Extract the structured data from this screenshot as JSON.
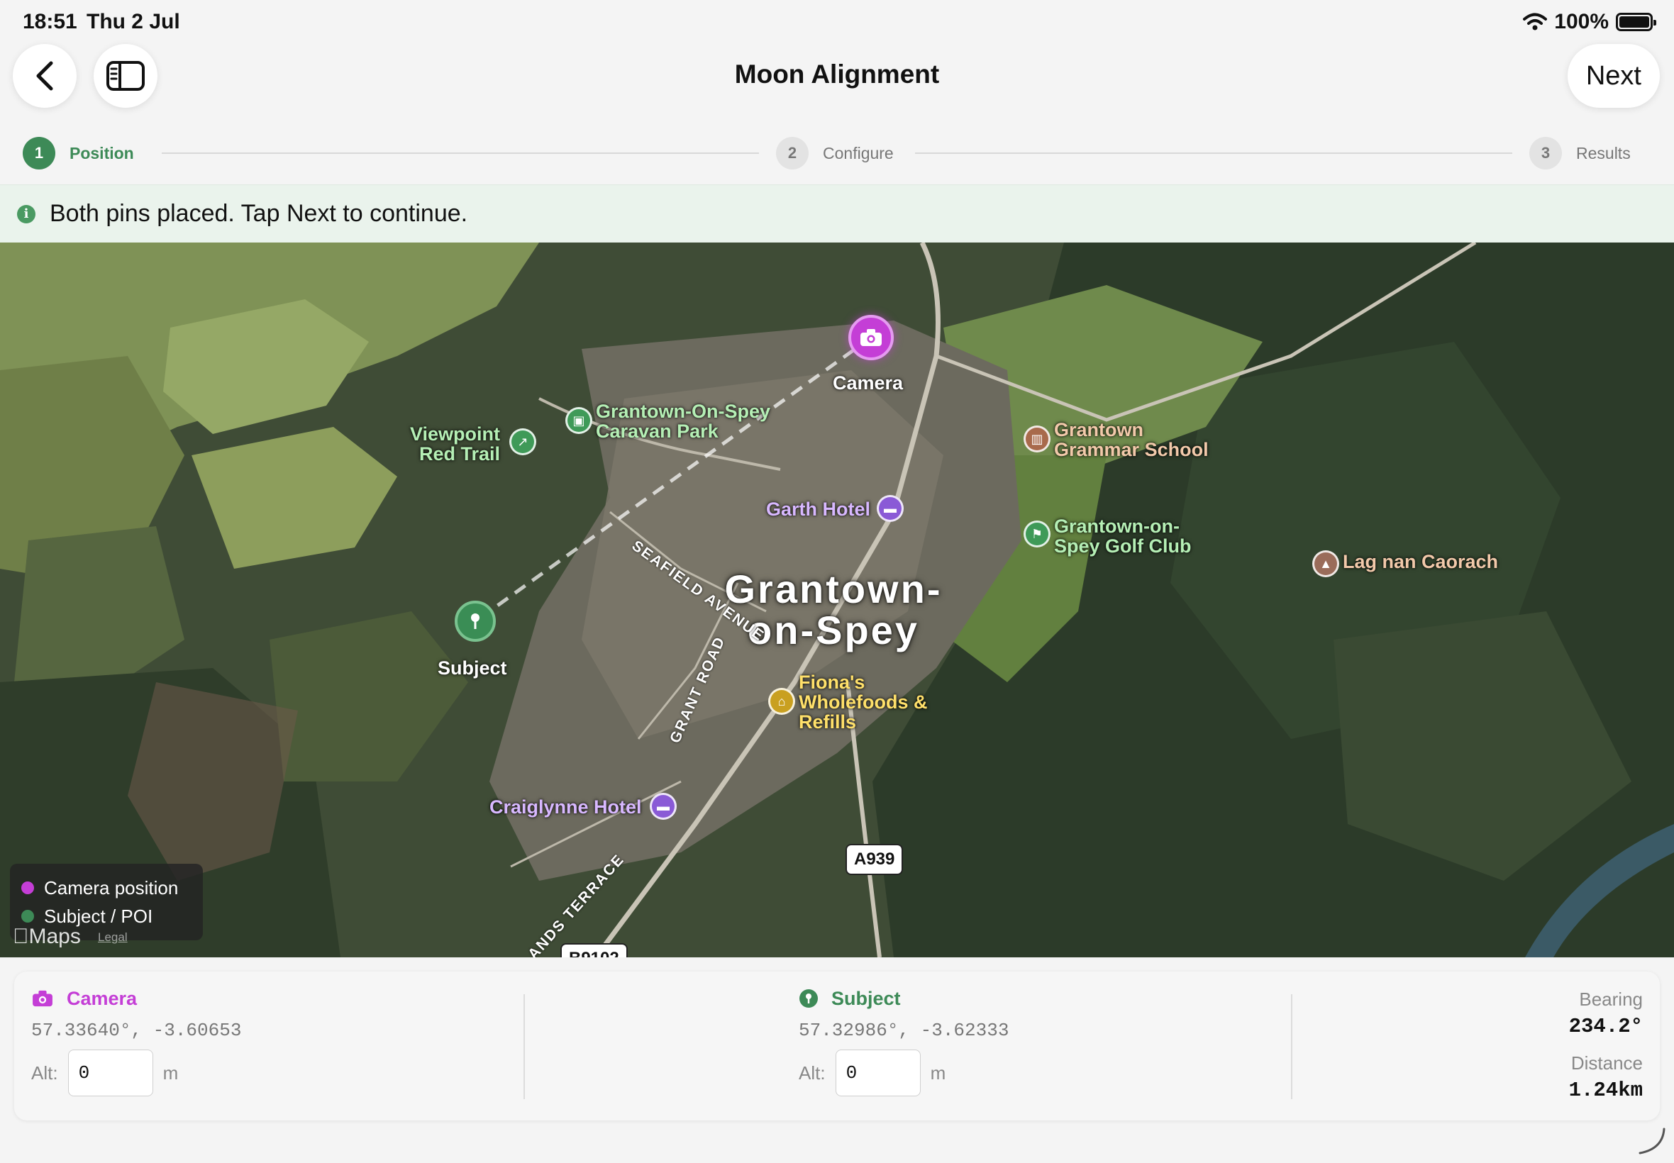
{
  "status_bar": {
    "time": "18:51",
    "date": "Thu 2 Jul",
    "battery": "100%"
  },
  "nav": {
    "title": "Moon Alignment",
    "next_label": "Next"
  },
  "stepper": {
    "steps": [
      {
        "number": "1",
        "label": "Position"
      },
      {
        "number": "2",
        "label": "Configure"
      },
      {
        "number": "3",
        "label": "Results"
      }
    ]
  },
  "banner": {
    "text": "Both pins placed. Tap Next to continue."
  },
  "map": {
    "town": "Grantown-\non-Spey",
    "pins": {
      "camera": "Camera",
      "subject": "Subject"
    },
    "pois": {
      "viewpoint": "Viewpoint\nRed Trail",
      "caravan_park": "Grantown-On-Spey\nCaravan Park",
      "grammar_school": "Grantown\nGrammar School",
      "garth_hotel": "Garth Hotel",
      "golf_club": "Grantown-on-\nSpey Golf Club",
      "lag_nan_caorach": "Lag nan Caorach",
      "fionas": "Fiona's\nWholefoods &\nRefills",
      "craiglynne": "Craiglynne Hotel"
    },
    "roads": {
      "seafield": "SEAFIELD AVENUE",
      "grant_road": "GRANT ROAD",
      "terrace": "ANDS TERRACE",
      "a939": "A939",
      "b9102": "B9102"
    },
    "legend": {
      "camera": "Camera position",
      "subject": "Subject / POI"
    },
    "attribution": "Maps",
    "legal": "Legal"
  },
  "panel": {
    "camera": {
      "title": "Camera",
      "coords": "57.33640°, -3.60653",
      "alt_label": "Alt:",
      "alt_value": "0",
      "unit": "m"
    },
    "subject": {
      "title": "Subject",
      "coords": "57.32986°, -3.62333",
      "alt_label": "Alt:",
      "alt_value": "0",
      "unit": "m"
    },
    "bearing": {
      "label": "Bearing",
      "value": "234.2°"
    },
    "distance": {
      "label": "Distance",
      "value": "1.24km"
    }
  },
  "colors": {
    "accent_green": "#3d8a57",
    "camera_magenta": "#c43ed6",
    "banner_bg": "#eaf3ec"
  }
}
